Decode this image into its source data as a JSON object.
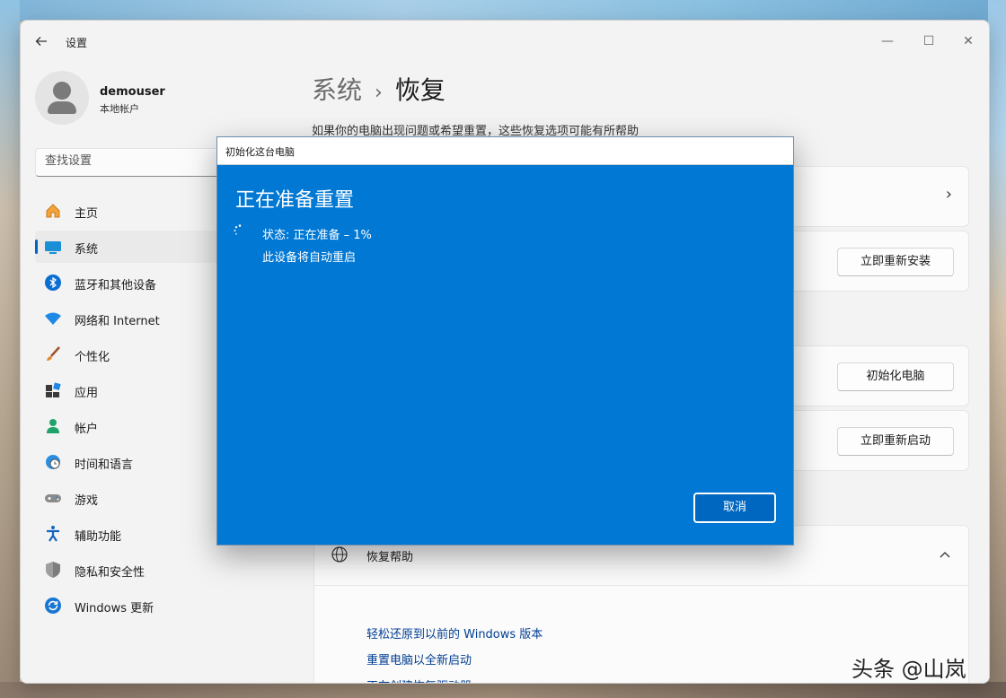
{
  "window": {
    "app_title": "设置",
    "controls": {
      "minimize": "—",
      "maximize": "☐",
      "close": "✕"
    }
  },
  "profile": {
    "username": "demouser",
    "account_type": "本地帐户"
  },
  "search": {
    "placeholder": "查找设置"
  },
  "sidebar": {
    "items": [
      {
        "label": "主页",
        "icon": "home-icon"
      },
      {
        "label": "系统",
        "icon": "system-icon",
        "active": true
      },
      {
        "label": "蓝牙和其他设备",
        "icon": "bluetooth-icon"
      },
      {
        "label": "网络和 Internet",
        "icon": "wifi-icon"
      },
      {
        "label": "个性化",
        "icon": "brush-icon"
      },
      {
        "label": "应用",
        "icon": "apps-icon"
      },
      {
        "label": "帐户",
        "icon": "account-icon"
      },
      {
        "label": "时间和语言",
        "icon": "globe-clock-icon"
      },
      {
        "label": "游戏",
        "icon": "gamepad-icon"
      },
      {
        "label": "辅助功能",
        "icon": "accessibility-icon"
      },
      {
        "label": "隐私和安全性",
        "icon": "shield-icon"
      },
      {
        "label": "Windows 更新",
        "icon": "update-icon"
      }
    ]
  },
  "header": {
    "breadcrumb_parent": "系统",
    "breadcrumb_separator": "›",
    "breadcrumb_current": "恢复",
    "description": "如果你的电脑出现问题或希望重置，这些恢复选项可能有所帮助"
  },
  "cards": {
    "reinstall_button": "立即重新安装",
    "reset_button": "初始化电脑",
    "restart_button": "立即重新启动"
  },
  "help": {
    "title": "恢复帮助",
    "links": [
      "轻松还原到以前的 Windows 版本",
      "重置电脑以全新启动",
      "正在创建恢复驱动器"
    ]
  },
  "dialog": {
    "title": "初始化这台电脑",
    "heading": "正在准备重置",
    "status": "状态: 正在准备 – 1%",
    "note": "此设备将自动重启",
    "cancel_label": "取消"
  },
  "watermark": "头条 @山岚",
  "colors": {
    "accent": "#0078d4",
    "dialog_bg": "#0078d4",
    "link": "#003e92"
  }
}
